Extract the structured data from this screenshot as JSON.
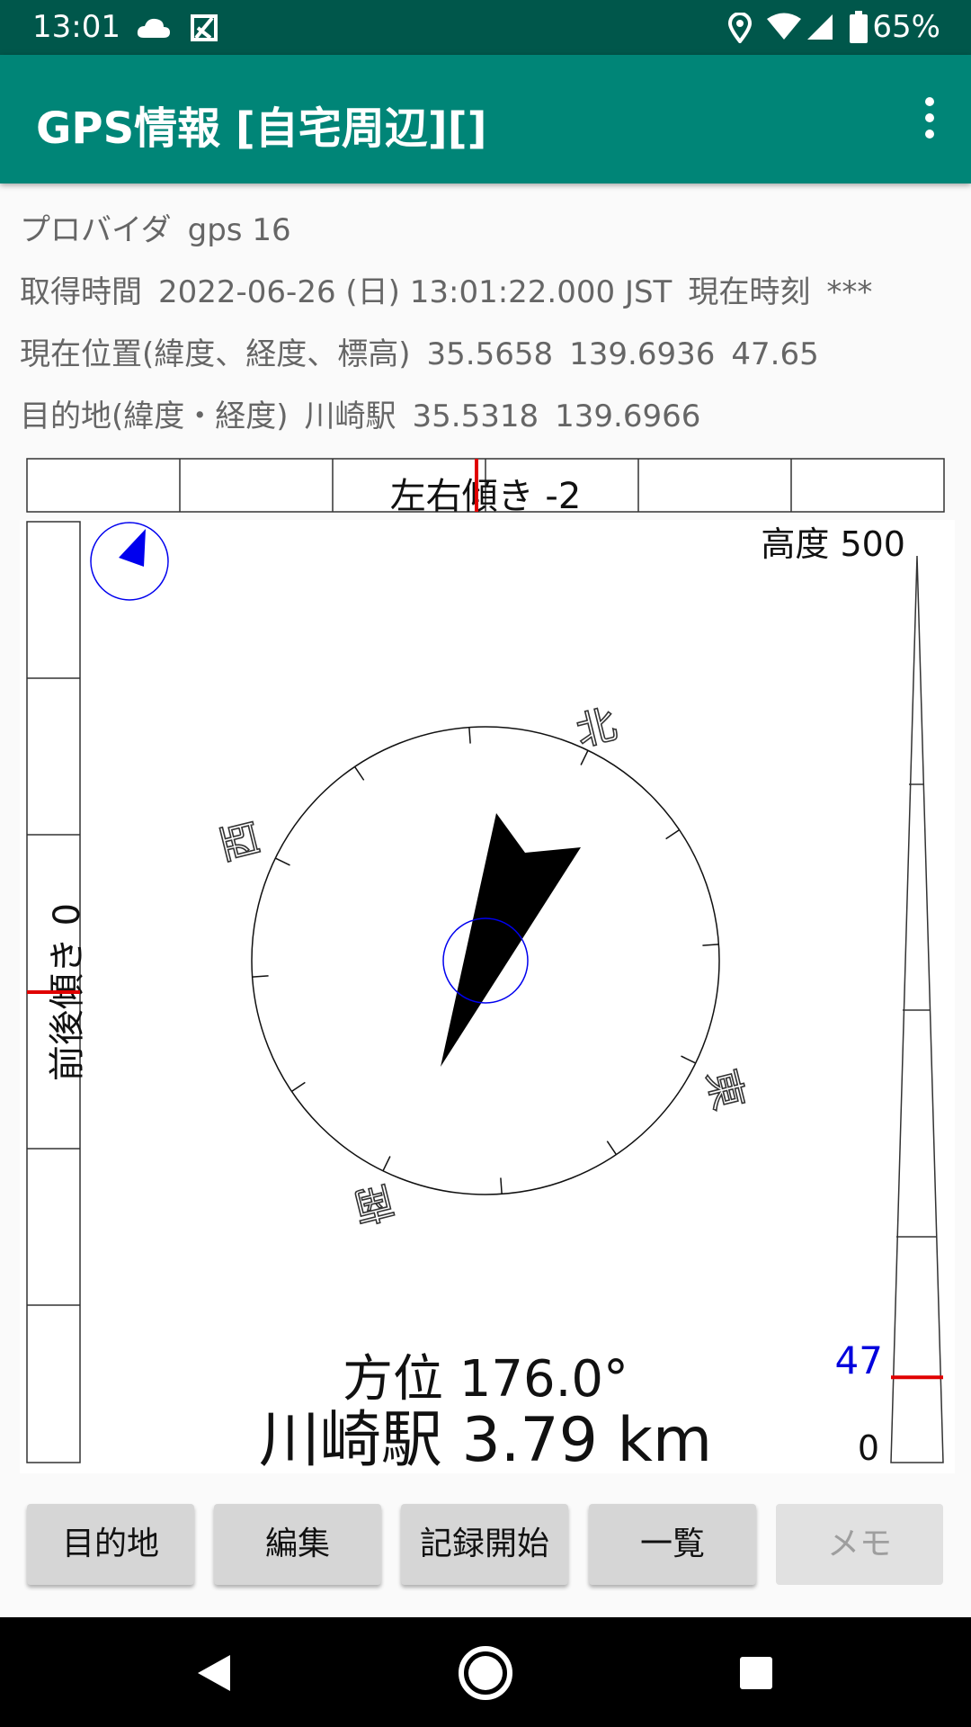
{
  "status_bar": {
    "time": "13:01",
    "battery_percent": "65%",
    "icons": [
      "cloud-icon",
      "app-k-icon",
      "location-icon",
      "wifi-icon",
      "cell-signal-icon",
      "battery-icon"
    ]
  },
  "app_bar": {
    "title": "GPS情報 [自宅周辺][]",
    "menu_icon": "overflow-menu-icon",
    "background": "#008577"
  },
  "info": {
    "provider_label": "プロバイダ",
    "provider_value": "gps 16",
    "time_label": "取得時間",
    "time_value": "2022-06-26 (日) 13:01:22.000 JST",
    "now_label": "現在時刻",
    "now_value": "***",
    "position_label": "現在位置(緯度、経度、標高)",
    "position_lat": "35.5658",
    "position_lon": "139.6936",
    "position_alt": "47.65",
    "dest_label": "目的地(緯度・経度)",
    "dest_name": "川崎駅",
    "dest_lat": "35.5318",
    "dest_lon": "139.6966"
  },
  "gauges": {
    "roll_label": "左右傾き -2",
    "pitch_label": "前後傾き 0",
    "altitude_max_label": "高度 500",
    "altitude_zero_label": "0",
    "altitude_current_label": "47",
    "altitude_current_fraction": 0.094,
    "accent_color": "#e00000",
    "altitude_value_color": "#0000dd"
  },
  "compass": {
    "north_label": "北",
    "east_label": "東",
    "south_label": "南",
    "west_label": "西",
    "bearing_text": "方位 176.0°",
    "distance_text": "川崎駅 3.79 km",
    "mini_compass_color": "#0000ee"
  },
  "buttons": {
    "destination": "目的地",
    "edit": "編集",
    "record_start": "記録開始",
    "list": "一覧",
    "memo": "メモ"
  },
  "nav_bar": {
    "back_icon": "back-triangle-icon",
    "home_icon": "home-circle-icon",
    "recents_icon": "recents-square-icon"
  }
}
